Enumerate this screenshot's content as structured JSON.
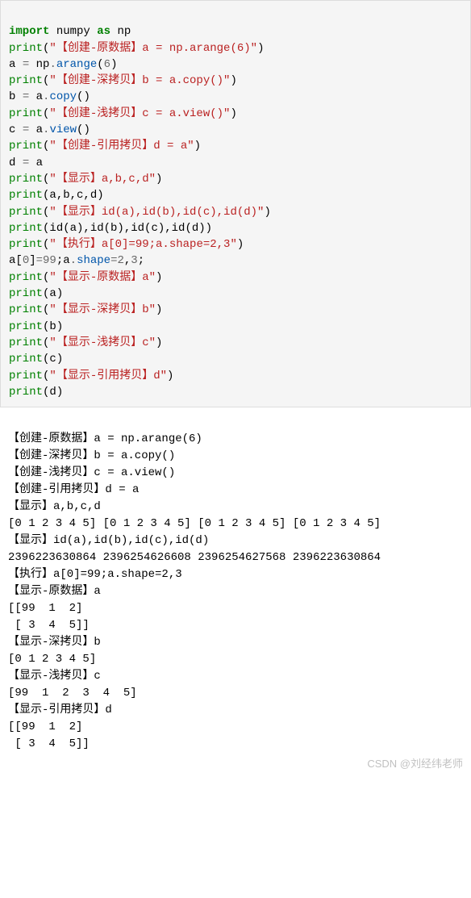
{
  "code": {
    "l1": {
      "kw1": "import",
      "sp1": " ",
      "mod": "numpy",
      "sp2": " ",
      "kw2": "as",
      "sp3": " ",
      "alias": "np"
    },
    "l2": {
      "fn": "print",
      "lp": "(",
      "str": "\"【创建-原数据】a = np.arange(6)\"",
      "rp": ")"
    },
    "l3": {
      "pre": "a ",
      "eq": "=",
      "sp": " np",
      "dot": ".",
      "meth": "arange",
      "lp": "(",
      "num": "6",
      "rp": ")"
    },
    "l4": {
      "fn": "print",
      "lp": "(",
      "str": "\"【创建-深拷贝】b = a.copy()\"",
      "rp": ")"
    },
    "l5": {
      "pre": "b ",
      "eq": "=",
      "sp": " a",
      "dot": ".",
      "meth": "copy",
      "lp": "(",
      "rp": ")"
    },
    "l6": {
      "fn": "print",
      "lp": "(",
      "str": "\"【创建-浅拷贝】c = a.view()\"",
      "rp": ")"
    },
    "l7": {
      "pre": "c ",
      "eq": "=",
      "sp": " a",
      "dot": ".",
      "meth": "view",
      "lp": "(",
      "rp": ")"
    },
    "l8": {
      "fn": "print",
      "lp": "(",
      "str": "\"【创建-引用拷贝】d = a\"",
      "rp": ")"
    },
    "l9": {
      "pre": "d ",
      "eq": "=",
      "rest": " a"
    },
    "l10": {
      "fn": "print",
      "lp": "(",
      "str": "\"【显示】a,b,c,d\"",
      "rp": ")"
    },
    "l11": {
      "fn": "print",
      "lp": "(",
      "args": "a,b,c,d",
      "rp": ")"
    },
    "l12": {
      "fn": "print",
      "lp": "(",
      "str": "\"【显示】id(a),id(b),id(c),id(d)\"",
      "rp": ")"
    },
    "l13": {
      "fn": "print",
      "lp": "(",
      "args": "id(a),id(b),id(c),id(d)",
      "rp": ")"
    },
    "l14": {
      "fn": "print",
      "lp": "(",
      "str": "\"【执行】a[0]=99;a.shape=2,3\"",
      "rp": ")"
    },
    "l15": {
      "pre": "a[",
      "num1": "0",
      "mid": "]",
      "eq": "=",
      "num2": "99",
      "semi": ";a",
      "dot": ".",
      "attr": "shape",
      "eq2": "=",
      "num3": "2",
      "comma": ",",
      "num4": "3",
      "semi2": ";"
    },
    "l16": {
      "fn": "print",
      "lp": "(",
      "str": "\"【显示-原数据】a\"",
      "rp": ")"
    },
    "l17": {
      "fn": "print",
      "lp": "(",
      "args": "a",
      "rp": ")"
    },
    "l18": {
      "fn": "print",
      "lp": "(",
      "str": "\"【显示-深拷贝】b\"",
      "rp": ")"
    },
    "l19": {
      "fn": "print",
      "lp": "(",
      "args": "b",
      "rp": ")"
    },
    "l20": {
      "fn": "print",
      "lp": "(",
      "str": "\"【显示-浅拷贝】c\"",
      "rp": ")"
    },
    "l21": {
      "fn": "print",
      "lp": "(",
      "args": "c",
      "rp": ")"
    },
    "l22": {
      "fn": "print",
      "lp": "(",
      "str": "\"【显示-引用拷贝】d\"",
      "rp": ")"
    },
    "l23": {
      "fn": "print",
      "lp": "(",
      "args": "d",
      "rp": ")"
    }
  },
  "output": {
    "o1": "【创建-原数据】a = np.arange(6)",
    "o2": "【创建-深拷贝】b = a.copy()",
    "o3": "【创建-浅拷贝】c = a.view()",
    "o4": "【创建-引用拷贝】d = a",
    "o5": "【显示】a,b,c,d",
    "o6": "[0 1 2 3 4 5] [0 1 2 3 4 5] [0 1 2 3 4 5] [0 1 2 3 4 5]",
    "o7": "【显示】id(a),id(b),id(c),id(d)",
    "o8": "2396223630864 2396254626608 2396254627568 2396223630864",
    "o9": "【执行】a[0]=99;a.shape=2,3",
    "o10": "【显示-原数据】a",
    "o11": "[[99  1  2]\n [ 3  4  5]]",
    "o12": "【显示-深拷贝】b",
    "o13": "[0 1 2 3 4 5]",
    "o14": "【显示-浅拷贝】c",
    "o15": "[99  1  2  3  4  5]",
    "o16": "【显示-引用拷贝】d",
    "o17": "[[99  1  2]\n [ 3  4  5]]"
  },
  "watermark": "CSDN @刘经纬老师"
}
